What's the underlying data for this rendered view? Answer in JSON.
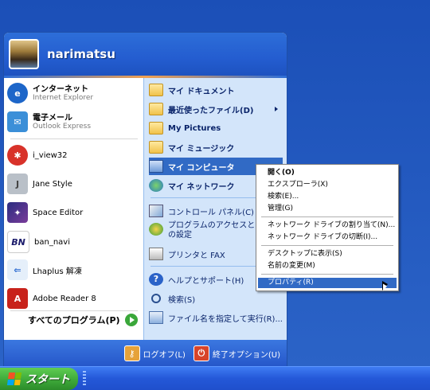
{
  "user": {
    "name": "narimatsu"
  },
  "left": {
    "pinned": [
      {
        "title": "インターネット",
        "subtitle": "Internet Explorer",
        "icon": "internet-explorer-icon"
      },
      {
        "title": "電子メール",
        "subtitle": "Outlook Express",
        "icon": "outlook-express-icon"
      }
    ],
    "recent": [
      {
        "label": "i_view32",
        "icon": "irfanview-icon"
      },
      {
        "label": "Jane Style",
        "icon": "jane-style-icon"
      },
      {
        "label": "Space Editor",
        "icon": "space-editor-icon"
      },
      {
        "label": "ban_navi",
        "icon": "bannavi-icon"
      },
      {
        "label": "Lhaplus 解凍",
        "icon": "lhaplus-icon"
      },
      {
        "label": "Adobe Reader 8",
        "icon": "adobe-reader-icon"
      }
    ],
    "all_programs": "すべてのプログラム(P)"
  },
  "right": {
    "items": [
      {
        "label": "マイ ドキュメント",
        "icon": "folder-icon"
      },
      {
        "label": "最近使ったファイル(D)",
        "icon": "folder-icon"
      },
      {
        "label": "My Pictures",
        "icon": "folder-icon"
      },
      {
        "label": "マイ ミュージック",
        "icon": "folder-icon"
      },
      {
        "label": "マイ コンピュータ",
        "icon": "computer-icon"
      },
      {
        "label": "マイ ネットワーク",
        "icon": "network-icon"
      },
      {
        "label": "コントロール パネル(C)",
        "icon": "control-panel-icon"
      },
      {
        "label": "プログラムのアクセスと既定",
        "label2": "の設定",
        "icon": "program-access-icon"
      },
      {
        "label": "プリンタと FAX",
        "icon": "printer-icon"
      },
      {
        "label": "ヘルプとサポート(H)",
        "icon": "help-icon"
      },
      {
        "label": "検索(S)",
        "icon": "search-icon"
      },
      {
        "label": "ファイル名を指定して実行(R)...",
        "icon": "run-icon"
      }
    ]
  },
  "footer": {
    "logoff": "ログオフ(L)",
    "shutdown": "終了オプション(U)"
  },
  "context_menu": {
    "items": [
      "開く(O)",
      "エクスプローラ(X)",
      "検索(E)...",
      "管理(G)",
      "ネットワーク ドライブの割り当て(N)...",
      "ネットワーク ドライブの切断(I)...",
      "デスクトップに表示(S)",
      "名前の変更(M)",
      "プロパティ(R)"
    ]
  },
  "taskbar": {
    "start_label": "スタート"
  },
  "colors": {
    "accent": "#316ac5",
    "header_blue": "#2d6ed8",
    "right_pane": "#d3e5fa",
    "start_green": "#3ea93a"
  }
}
